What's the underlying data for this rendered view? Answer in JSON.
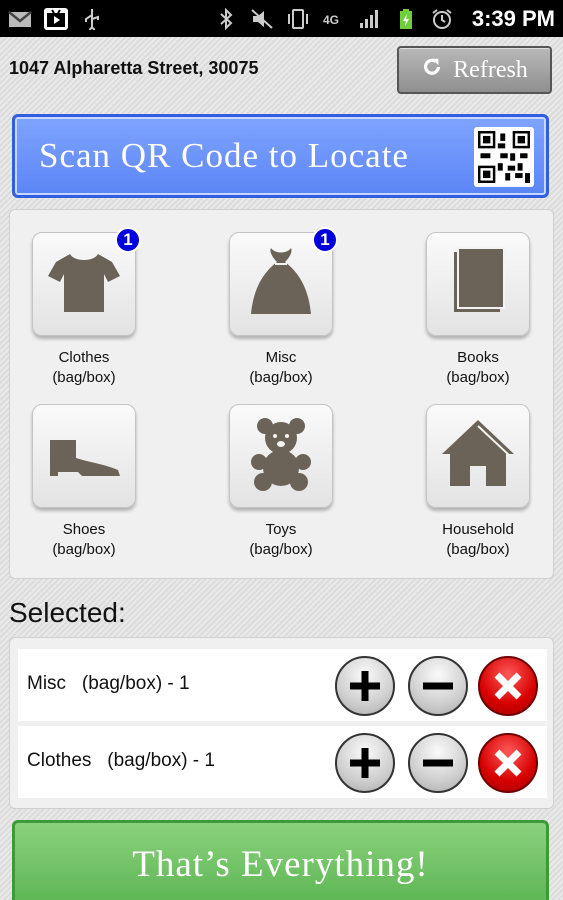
{
  "status_bar": {
    "time": "3:39 PM",
    "left_icons": [
      "gmail-icon",
      "play-store-icon",
      "usb-icon"
    ],
    "right_icons": [
      "bluetooth-icon",
      "mute-icon",
      "vibrate-icon",
      "network-4g-icon",
      "signal-icon",
      "battery-charging-icon",
      "alarm-icon"
    ]
  },
  "header": {
    "address": "1047 Alpharetta Street, 30075",
    "refresh_label": "Refresh"
  },
  "scan": {
    "label": "Scan QR Code to Locate"
  },
  "categories": [
    {
      "name": "Clothes",
      "unit": "(bag/box)",
      "badge": "1",
      "icon": "shirt-icon"
    },
    {
      "name": "Misc",
      "unit": "(bag/box)",
      "badge": "1",
      "icon": "sack-icon"
    },
    {
      "name": "Books",
      "unit": "(bag/box)",
      "badge": "",
      "icon": "book-icon"
    },
    {
      "name": "Shoes",
      "unit": "(bag/box)",
      "badge": "",
      "icon": "shoe-icon"
    },
    {
      "name": "Toys",
      "unit": "(bag/box)",
      "badge": "",
      "icon": "teddy-bear-icon"
    },
    {
      "name": "Household",
      "unit": "(bag/box)",
      "badge": "",
      "icon": "house-icon"
    }
  ],
  "selected": {
    "title": "Selected:",
    "items": [
      {
        "text": "Misc   (bag/box) - 1"
      },
      {
        "text": "Clothes   (bag/box) - 1"
      }
    ]
  },
  "footer": {
    "done_label": "That’s Everything!"
  },
  "colors": {
    "scan_blue": "#5b85f5",
    "done_green": "#5bb552",
    "badge_blue": "#0000dd",
    "remove_red": "#d60000",
    "icon_gray": "#6b6357"
  }
}
